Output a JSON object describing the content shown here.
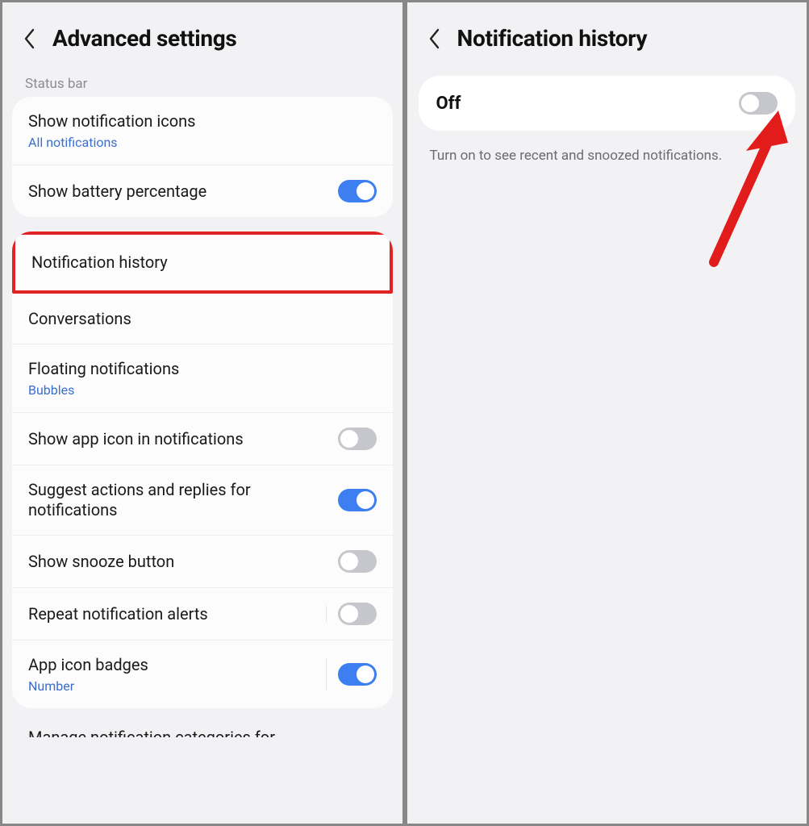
{
  "left": {
    "title": "Advanced settings",
    "section_label": "Status bar",
    "group1": {
      "notif_icons": {
        "title": "Show notification icons",
        "sub": "All notifications"
      },
      "battery": {
        "title": "Show battery percentage"
      }
    },
    "group2": {
      "history": {
        "title": "Notification history"
      },
      "conversations": {
        "title": "Conversations"
      },
      "floating": {
        "title": "Floating notifications",
        "sub": "Bubbles"
      },
      "app_icon": {
        "title": "Show app icon in notifications"
      },
      "suggest": {
        "title": "Suggest actions and replies for notifications"
      },
      "snooze": {
        "title": "Show snooze button"
      },
      "repeat": {
        "title": "Repeat notification alerts"
      },
      "badges": {
        "title": "App icon badges",
        "sub": "Number"
      }
    },
    "cutoff_text": "Manage notification categories for"
  },
  "right": {
    "title": "Notification history",
    "state": "Off",
    "description": "Turn on to see recent and snoozed notifications."
  }
}
